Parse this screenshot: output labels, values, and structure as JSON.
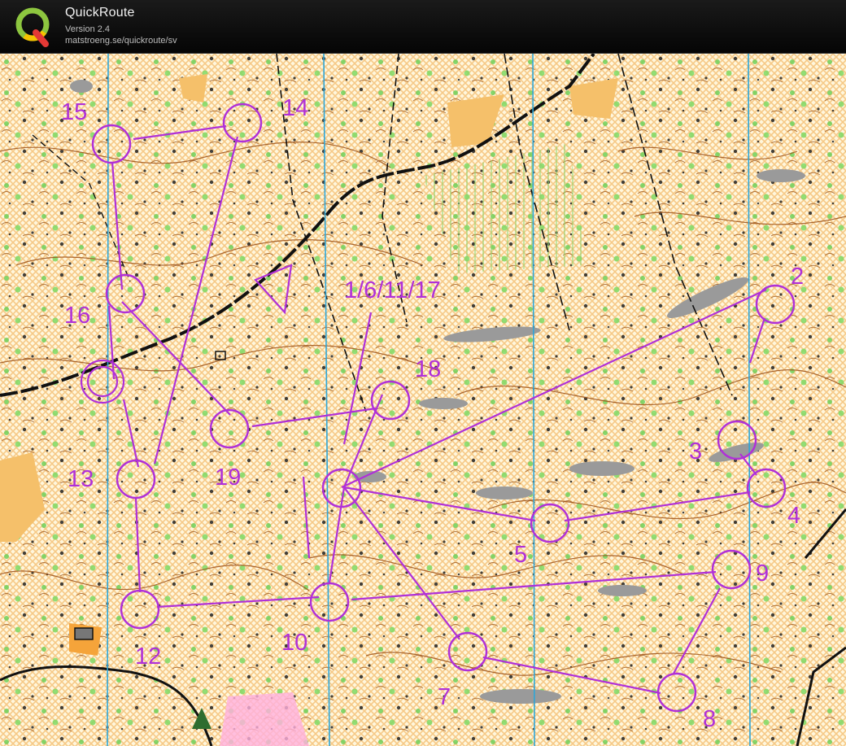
{
  "app": {
    "title": "QuickRoute",
    "version": "Version 2.4",
    "url": "matstroeng.se/quickroute/sv",
    "logo_letter": "Q",
    "icon": "quickroute-logo-icon"
  },
  "map": {
    "course_color": "#b030d8",
    "background_color": "#fff3d4",
    "meridian_color": "#2ea6d8",
    "start_label": "start-triangle",
    "finish_label": "finish-double-circle",
    "controls": [
      {
        "id": "c1",
        "label": "1/6/11/17"
      },
      {
        "id": "c2",
        "label": "2"
      },
      {
        "id": "c3",
        "label": "3"
      },
      {
        "id": "c4",
        "label": "4"
      },
      {
        "id": "c5",
        "label": "5"
      },
      {
        "id": "c7",
        "label": "7"
      },
      {
        "id": "c8",
        "label": "8"
      },
      {
        "id": "c9",
        "label": "9"
      },
      {
        "id": "c10",
        "label": "10"
      },
      {
        "id": "c12",
        "label": "12"
      },
      {
        "id": "c13",
        "label": "13"
      },
      {
        "id": "c14",
        "label": "14"
      },
      {
        "id": "c15",
        "label": "15"
      },
      {
        "id": "c16",
        "label": "16"
      },
      {
        "id": "c18",
        "label": "18"
      },
      {
        "id": "c19",
        "label": "19"
      }
    ]
  }
}
